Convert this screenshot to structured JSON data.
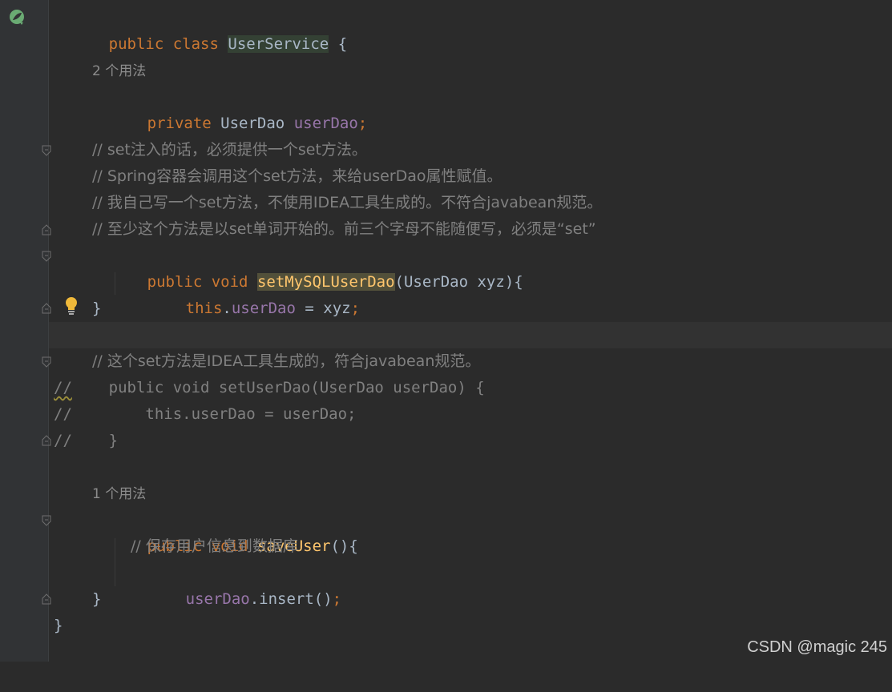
{
  "lines": {
    "l1": {
      "kw1": "public",
      "kw2": "class",
      "name": "UserService",
      "brace": "{"
    },
    "hint1": "2 个用法",
    "l3": {
      "kw": "private",
      "type": "UserDao",
      "field": "userDao",
      "semi": ";"
    },
    "c1": "// set注入的话，必须提供一个set方法。",
    "c2": "// Spring容器会调用这个set方法，来给userDao属性赋值。",
    "c3": "// 我自己写一个set方法，不使用IDEA工具生成的。不符合javabean规范。",
    "c4": "// 至少这个方法是以set单词开始的。前三个字母不能随便写，必须是“set”",
    "m1": {
      "kw1": "public",
      "kw2": "void",
      "name": "setMySQLUserDao",
      "params": "(UserDao xyz){"
    },
    "m1b": {
      "kw": "this",
      "dot": ".",
      "field": "userDao",
      "rest": " = xyz",
      "semi": ";"
    },
    "m1c": "}",
    "c5": "// 这个set方法是IDEA工具生成的，符合javabean规范。",
    "cc1": {
      "mark": "//",
      "rest": "    public void setUserDao(UserDao userDao) {"
    },
    "cc2": "//        this.userDao = userDao;",
    "cc3": "//    }",
    "hint2": "1 个用法",
    "m2": {
      "kw1": "public",
      "kw2": "void",
      "name": "saveUser",
      "params": "(){"
    },
    "m2c": "// 保存用户信息到数据库",
    "m2b": {
      "field": "userDao",
      "call": ".insert()",
      "semi": ";"
    },
    "m2e": "}",
    "end": "}"
  },
  "watermark": "CSDN @magic 245",
  "colors": {
    "background": "#2b2b2b",
    "keyword": "#cc7832",
    "field": "#9876aa",
    "method": "#ffc66d",
    "comment": "#808080",
    "text": "#a9b7c6"
  }
}
